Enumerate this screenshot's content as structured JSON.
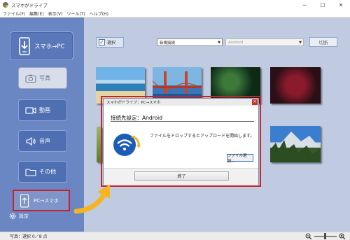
{
  "app": {
    "title": "スマホがドライブ"
  },
  "window_controls": [
    "─",
    "☐",
    "✕"
  ],
  "menu": [
    "ファイル(F)",
    "編集(E)",
    "表示(V)",
    "ツール(T)",
    "ヘルプ(H)"
  ],
  "sidebar": {
    "main_button": "スマホ→PC",
    "items": [
      {
        "label": "写真",
        "icon": "camera-icon",
        "selected": true
      },
      {
        "label": "動画",
        "icon": "video-icon",
        "selected": false
      },
      {
        "label": "音声",
        "icon": "speaker-icon",
        "selected": false
      },
      {
        "label": "その他",
        "icon": "folder-icon",
        "selected": false
      }
    ],
    "pc_button": "PC→スマホ",
    "settings": "設定"
  },
  "toolbar": {
    "select_checkbox": "選択",
    "connection_select": "新規接続",
    "device_select": "Android",
    "disconnect_button": "切断"
  },
  "dialog": {
    "title": "スマホがドライブ：PC→スマホ",
    "heading": "接続先設定：Android",
    "message": "ファイルをドロップするとアップロードを開始します。",
    "file_button": "ファイル選択...",
    "end_button": "終了"
  },
  "status": {
    "text": "写真：選択 0／8 点",
    "zoom_level": 0.45
  },
  "colors": {
    "sidebar": "#6a86c3",
    "main_bg": "#c0cbe1",
    "highlight_red": "#c7212b",
    "arrow_orange": "#f4b521"
  }
}
